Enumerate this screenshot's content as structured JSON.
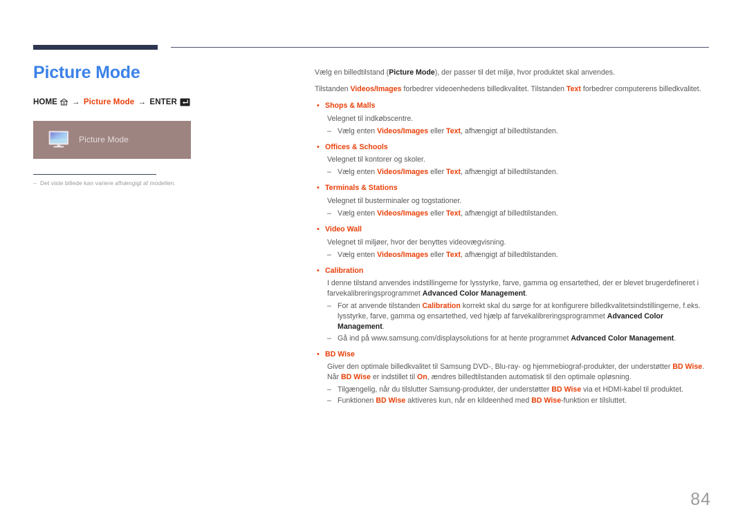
{
  "header": {
    "rule_thick_color": "#2e3550",
    "rule_thin_color": "#4b5068"
  },
  "left": {
    "title": "Picture Mode",
    "title_color": "#3c82e8",
    "breadcrumb": {
      "home_label": "HOME",
      "home_icon": "home-icon",
      "arrow1": "→",
      "menu_label": "Picture Mode",
      "arrow2": "→",
      "enter_label": "ENTER",
      "enter_icon": "enter-key-icon",
      "accent_color": "#e8400a"
    },
    "osd": {
      "label": "Picture Mode",
      "icon": "monitor-icon",
      "background_color": "#9d8481"
    },
    "note": {
      "dash": "‒",
      "text": "Det viste billede kan variere afhængigt af modellen."
    }
  },
  "content": {
    "intro": [
      {
        "parts": [
          {
            "t": "Vælg en billedtilstand (",
            "s": "n"
          },
          {
            "t": "Picture Mode",
            "s": "d"
          },
          {
            "t": "), der passer til det miljø, hvor produktet skal anvendes.",
            "s": "n"
          }
        ]
      },
      {
        "parts": [
          {
            "t": "Tilstanden ",
            "s": "n"
          },
          {
            "t": "Videos/Images",
            "s": "a"
          },
          {
            "t": " forbedrer videoenhedens billedkvalitet. Tilstanden ",
            "s": "n"
          },
          {
            "t": "Text",
            "s": "a"
          },
          {
            "t": " forbedrer computerens billedkvalitet.",
            "s": "n"
          }
        ]
      }
    ],
    "bullet_char": "•",
    "dash_char": "‒",
    "items": [
      {
        "title": "Shops & Malls",
        "body": [
          {
            "parts": [
              {
                "t": "Velegnet til indkøbscentre.",
                "s": "n"
              }
            ]
          }
        ],
        "subs": [
          {
            "parts": [
              {
                "t": "Vælg enten ",
                "s": "n"
              },
              {
                "t": "Videos/Images",
                "s": "a"
              },
              {
                "t": " eller ",
                "s": "n"
              },
              {
                "t": "Text",
                "s": "a"
              },
              {
                "t": ", afhængigt af billedtilstanden.",
                "s": "n"
              }
            ]
          }
        ]
      },
      {
        "title": "Offices & Schools",
        "body": [
          {
            "parts": [
              {
                "t": "Velegnet til kontorer og skoler.",
                "s": "n"
              }
            ]
          }
        ],
        "subs": [
          {
            "parts": [
              {
                "t": "Vælg enten ",
                "s": "n"
              },
              {
                "t": "Videos/Images",
                "s": "a"
              },
              {
                "t": " eller ",
                "s": "n"
              },
              {
                "t": "Text",
                "s": "a"
              },
              {
                "t": ", afhængigt af billedtilstanden.",
                "s": "n"
              }
            ]
          }
        ]
      },
      {
        "title": "Terminals & Stations",
        "body": [
          {
            "parts": [
              {
                "t": "Velegnet til busterminaler og togstationer.",
                "s": "n"
              }
            ]
          }
        ],
        "subs": [
          {
            "parts": [
              {
                "t": "Vælg enten ",
                "s": "n"
              },
              {
                "t": "Videos/Images",
                "s": "a"
              },
              {
                "t": " eller ",
                "s": "n"
              },
              {
                "t": "Text",
                "s": "a"
              },
              {
                "t": ", afhængigt af billedtilstanden.",
                "s": "n"
              }
            ]
          }
        ]
      },
      {
        "title": "Video Wall",
        "body": [
          {
            "parts": [
              {
                "t": "Velegnet til miljøer, hvor der benyttes videovægvisning.",
                "s": "n"
              }
            ]
          }
        ],
        "subs": [
          {
            "parts": [
              {
                "t": "Vælg enten ",
                "s": "n"
              },
              {
                "t": "Videos/Images",
                "s": "a"
              },
              {
                "t": " eller ",
                "s": "n"
              },
              {
                "t": "Text",
                "s": "a"
              },
              {
                "t": ", afhængigt af billedtilstanden.",
                "s": "n"
              }
            ]
          }
        ]
      },
      {
        "title": "Calibration",
        "body": [
          {
            "parts": [
              {
                "t": "I denne tilstand anvendes indstillingerne for lysstyrke, farve, gamma og ensartethed, der er blevet brugerdefineret i farvekalibreringsprogrammet ",
                "s": "n"
              },
              {
                "t": "Advanced Color Management",
                "s": "d"
              },
              {
                "t": ".",
                "s": "n"
              }
            ]
          }
        ],
        "subs": [
          {
            "parts": [
              {
                "t": "For at anvende tilstanden ",
                "s": "n"
              },
              {
                "t": "Calibration",
                "s": "a"
              },
              {
                "t": " korrekt skal du sørge for at konfigurere billedkvalitetsindstillingerne, f.eks. lysstyrke, farve, gamma og ensartethed, ved hjælp af farvekalibreringsprogrammet ",
                "s": "n"
              },
              {
                "t": "Advanced Color Management",
                "s": "d"
              },
              {
                "t": ".",
                "s": "n"
              }
            ]
          },
          {
            "parts": [
              {
                "t": "Gå ind på www.samsung.com/displaysolutions for at hente programmet ",
                "s": "n"
              },
              {
                "t": "Advanced Color Management",
                "s": "d"
              },
              {
                "t": ".",
                "s": "n"
              }
            ]
          }
        ]
      },
      {
        "title": "BD Wise",
        "body": [
          {
            "parts": [
              {
                "t": "Giver den optimale billedkvalitet til Samsung DVD-, Blu-ray- og hjemmebiograf-produkter, der understøtter ",
                "s": "n"
              },
              {
                "t": "BD Wise",
                "s": "a"
              },
              {
                "t": ". Når ",
                "s": "n"
              },
              {
                "t": "BD Wise",
                "s": "a"
              },
              {
                "t": " er indstillet til ",
                "s": "n"
              },
              {
                "t": "On",
                "s": "a"
              },
              {
                "t": ", ændres billedtilstanden automatisk til den optimale opløsning.",
                "s": "n"
              }
            ]
          }
        ],
        "subs": [
          {
            "parts": [
              {
                "t": "Tilgængelig, når du tilslutter Samsung-produkter, der understøtter ",
                "s": "n"
              },
              {
                "t": "BD Wise",
                "s": "a"
              },
              {
                "t": " via et HDMI-kabel til produktet.",
                "s": "n"
              }
            ]
          },
          {
            "parts": [
              {
                "t": "Funktionen ",
                "s": "n"
              },
              {
                "t": "BD Wise",
                "s": "a"
              },
              {
                "t": " aktiveres kun, når en kildeenhed med ",
                "s": "n"
              },
              {
                "t": "BD Wise",
                "s": "a"
              },
              {
                "t": "-funktion er tilsluttet.",
                "s": "n"
              }
            ]
          }
        ]
      }
    ]
  },
  "footer": {
    "page_number": "84"
  }
}
